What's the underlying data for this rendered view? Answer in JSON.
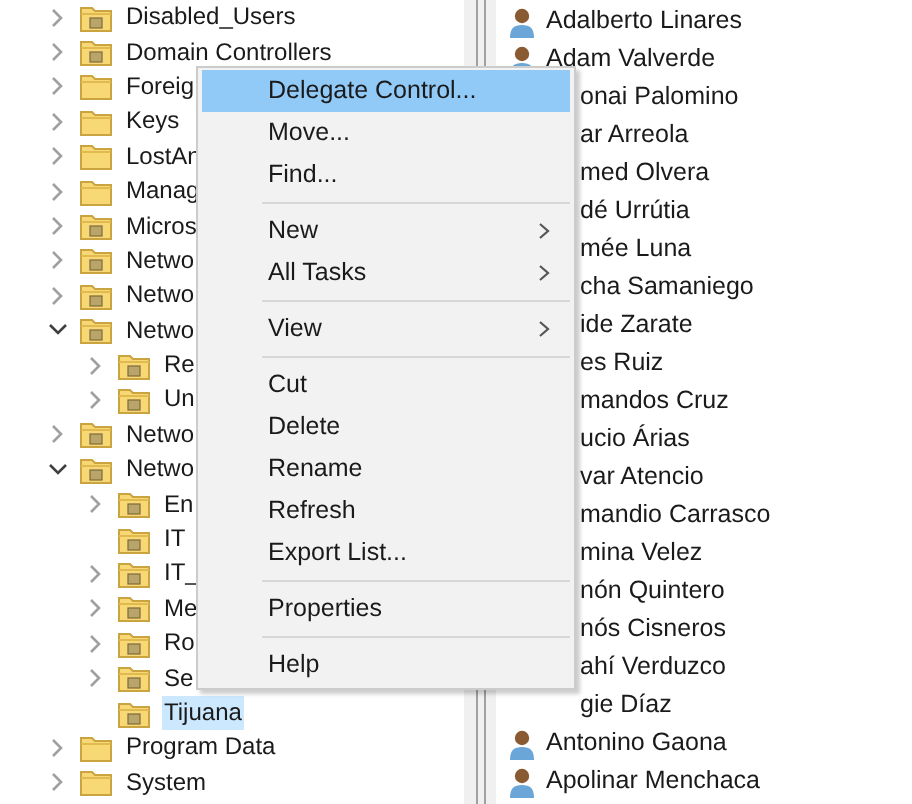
{
  "tree": [
    {
      "label": "Disabled_Users",
      "kind": "ou",
      "expanded": false
    },
    {
      "label": "Domain Controllers",
      "kind": "ou",
      "expanded": false
    },
    {
      "label": "Foreig",
      "kind": "container",
      "expanded": false
    },
    {
      "label": "Keys",
      "kind": "container",
      "expanded": false
    },
    {
      "label": "LostAn",
      "kind": "container",
      "expanded": false
    },
    {
      "label": "Manag",
      "kind": "container",
      "expanded": false
    },
    {
      "label": "Micros",
      "kind": "ou",
      "expanded": false
    },
    {
      "label": "Netwo",
      "kind": "ou",
      "expanded": false
    },
    {
      "label": "Netwo",
      "kind": "ou",
      "expanded": false
    },
    {
      "label": "Netwo",
      "kind": "ou",
      "expanded": true,
      "children": [
        {
          "label": "Re",
          "kind": "ou",
          "expanded": false
        },
        {
          "label": "Un",
          "kind": "ou",
          "expanded": false
        }
      ]
    },
    {
      "label": "Netwo",
      "kind": "ou",
      "expanded": false
    },
    {
      "label": "Netwo",
      "kind": "ou",
      "expanded": true,
      "children": [
        {
          "label": "En",
          "kind": "ou",
          "expanded": false
        },
        {
          "label": "IT",
          "kind": "ou-leaf",
          "selected": false
        },
        {
          "label": "IT_",
          "kind": "ou",
          "expanded": false
        },
        {
          "label": "Me",
          "kind": "ou",
          "expanded": false
        },
        {
          "label": "Ro",
          "kind": "ou",
          "expanded": false
        },
        {
          "label": "Se",
          "kind": "ou",
          "expanded": false
        },
        {
          "label": "Tijuana",
          "kind": "ou-leaf",
          "selected": true
        }
      ]
    },
    {
      "label": "Program Data",
      "kind": "container",
      "expanded": false
    },
    {
      "label": "System",
      "kind": "container",
      "expanded": false
    }
  ],
  "users": [
    {
      "name": "Adalberto Linares",
      "kind": "full"
    },
    {
      "name": "Adam Valverde",
      "kind": "full"
    },
    {
      "name": "onai Palomino",
      "kind": "partial"
    },
    {
      "name": "ar Arreola",
      "kind": "partial"
    },
    {
      "name": "med Olvera",
      "kind": "partial"
    },
    {
      "name": "dé Urrútia",
      "kind": "partial"
    },
    {
      "name": "mée Luna",
      "kind": "partial"
    },
    {
      "name": "cha Samaniego",
      "kind": "partial"
    },
    {
      "name": "ide Zarate",
      "kind": "partial"
    },
    {
      "name": "es Ruiz",
      "kind": "partial"
    },
    {
      "name": "mandos Cruz",
      "kind": "partial"
    },
    {
      "name": "ucio Árias",
      "kind": "partial"
    },
    {
      "name": "var Atencio",
      "kind": "partial"
    },
    {
      "name": "mandio Carrasco",
      "kind": "partial"
    },
    {
      "name": "mina Velez",
      "kind": "partial"
    },
    {
      "name": "nón Quintero",
      "kind": "partial"
    },
    {
      "name": "nós Cisneros",
      "kind": "partial"
    },
    {
      "name": "ahí Verduzco",
      "kind": "partial"
    },
    {
      "name": "gie Díaz",
      "kind": "partial"
    },
    {
      "name": "Antonino Gaona",
      "kind": "full"
    },
    {
      "name": "Apolinar Menchaca",
      "kind": "full"
    }
  ],
  "context_menu": [
    {
      "kind": "item",
      "label": "Delegate Control...",
      "selected": true,
      "submenu": false
    },
    {
      "kind": "item",
      "label": "Move...",
      "selected": false,
      "submenu": false
    },
    {
      "kind": "item",
      "label": "Find...",
      "selected": false,
      "submenu": false
    },
    {
      "kind": "separator"
    },
    {
      "kind": "item",
      "label": "New",
      "selected": false,
      "submenu": true
    },
    {
      "kind": "item",
      "label": "All Tasks",
      "selected": false,
      "submenu": true
    },
    {
      "kind": "separator"
    },
    {
      "kind": "item",
      "label": "View",
      "selected": false,
      "submenu": true
    },
    {
      "kind": "separator"
    },
    {
      "kind": "item",
      "label": "Cut",
      "selected": false,
      "submenu": false
    },
    {
      "kind": "item",
      "label": "Delete",
      "selected": false,
      "submenu": false
    },
    {
      "kind": "item",
      "label": "Rename",
      "selected": false,
      "submenu": false
    },
    {
      "kind": "item",
      "label": "Refresh",
      "selected": false,
      "submenu": false
    },
    {
      "kind": "item",
      "label": "Export List...",
      "selected": false,
      "submenu": false
    },
    {
      "kind": "separator"
    },
    {
      "kind": "item",
      "label": "Properties",
      "selected": false,
      "submenu": false
    },
    {
      "kind": "separator"
    },
    {
      "kind": "item",
      "label": "Help",
      "selected": false,
      "submenu": false
    }
  ]
}
